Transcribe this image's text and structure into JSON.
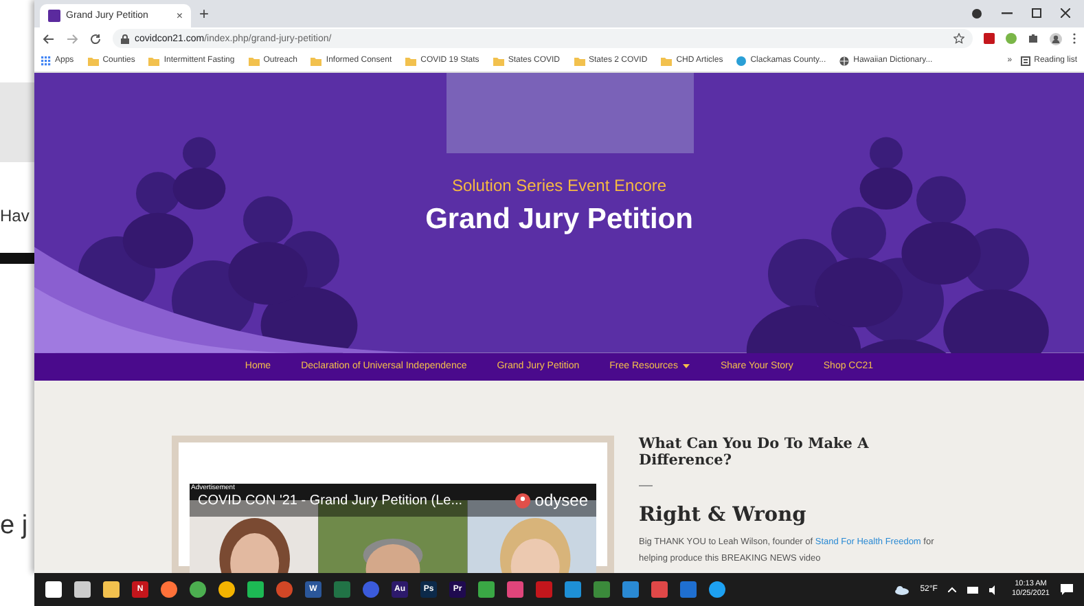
{
  "background_window": {
    "texts": [
      {
        "kind": "small",
        "text": "Hav"
      },
      {
        "kind": "large",
        "text": "e j"
      }
    ]
  },
  "browser": {
    "tab": {
      "title": "Grand Jury Petition",
      "close": "×"
    },
    "new_tab": "+",
    "address": {
      "host": "covidcon21.com",
      "path": "/index.php/grand-jury-petition/"
    },
    "bookmarks": [
      {
        "kind": "apps",
        "label": "Apps"
      },
      {
        "kind": "folder",
        "label": "Counties"
      },
      {
        "kind": "folder",
        "label": "Intermittent Fasting"
      },
      {
        "kind": "folder",
        "label": "Outreach"
      },
      {
        "kind": "folder",
        "label": "Informed Consent"
      },
      {
        "kind": "folder",
        "label": "COVID 19 Stats"
      },
      {
        "kind": "folder",
        "label": "States COVID"
      },
      {
        "kind": "folder",
        "label": "States 2 COVID"
      },
      {
        "kind": "folder",
        "label": "CHD Articles"
      },
      {
        "kind": "site",
        "label": "Clackamas County..."
      },
      {
        "kind": "globe",
        "label": "Hawaiian Dictionary..."
      }
    ],
    "more_bookmarks": "»",
    "reading_list": "Reading list"
  },
  "hero": {
    "kicker": "Solution Series Event Encore",
    "title": "Grand Jury Petition"
  },
  "nav": [
    {
      "label": "Home",
      "dropdown": false
    },
    {
      "label": "Declaration of Universal Independence",
      "dropdown": false
    },
    {
      "label": "Grand Jury Petition",
      "dropdown": false
    },
    {
      "label": "Free Resources",
      "dropdown": true
    },
    {
      "label": "Share Your Story",
      "dropdown": false
    },
    {
      "label": "Shop CC21",
      "dropdown": false
    }
  ],
  "video": {
    "ad_label": "Advertisement",
    "title": "COVID CON '21 - Grand Jury Petition (Le...",
    "brand": "odysee"
  },
  "article": {
    "question": "What Can You Do To Make A Difference?",
    "heading": "Right & Wrong",
    "intro": "Big THANK YOU to Leah Wilson, founder of",
    "link": "Stand For Health Freedom",
    "rest": "for helping produce this BREAKING NEWS video"
  },
  "taskbar": {
    "apps": [
      {
        "kind": "start",
        "color": "#ffffff"
      },
      {
        "kind": "taskview",
        "color": "#cccccc"
      },
      {
        "kind": "folder",
        "color": "#f2c14e"
      },
      {
        "kind": "tile",
        "color": "#c4161c",
        "label": "N"
      },
      {
        "kind": "circle",
        "color": "#ff7139"
      },
      {
        "kind": "circle",
        "color": "#4caf50"
      },
      {
        "kind": "circle",
        "color": "#f4b400"
      },
      {
        "kind": "tile",
        "color": "#1db954"
      },
      {
        "kind": "circle",
        "color": "#d24726"
      },
      {
        "kind": "tile",
        "color": "#2b579a",
        "label": "W"
      },
      {
        "kind": "tile",
        "color": "#217346"
      },
      {
        "kind": "circle",
        "color": "#3b5bdb"
      },
      {
        "kind": "tile",
        "color": "#2d1a6b",
        "label": "Au"
      },
      {
        "kind": "tile",
        "color": "#0c2a4a",
        "label": "Ps"
      },
      {
        "kind": "tile",
        "color": "#1f0a4f",
        "label": "Pr"
      },
      {
        "kind": "tile",
        "color": "#3aa845"
      },
      {
        "kind": "tile",
        "color": "#e0457b"
      },
      {
        "kind": "tile",
        "color": "#c4161c"
      },
      {
        "kind": "tile",
        "color": "#1e90d6"
      },
      {
        "kind": "tile",
        "color": "#3b8a3b"
      },
      {
        "kind": "tile",
        "color": "#2a8ad4"
      },
      {
        "kind": "tile",
        "color": "#e04848"
      },
      {
        "kind": "tile",
        "color": "#1f6fd1"
      },
      {
        "kind": "circle",
        "color": "#1da1f2"
      }
    ],
    "temperature": "52°F",
    "time": "10:13 AM",
    "date": "10/25/2021"
  }
}
